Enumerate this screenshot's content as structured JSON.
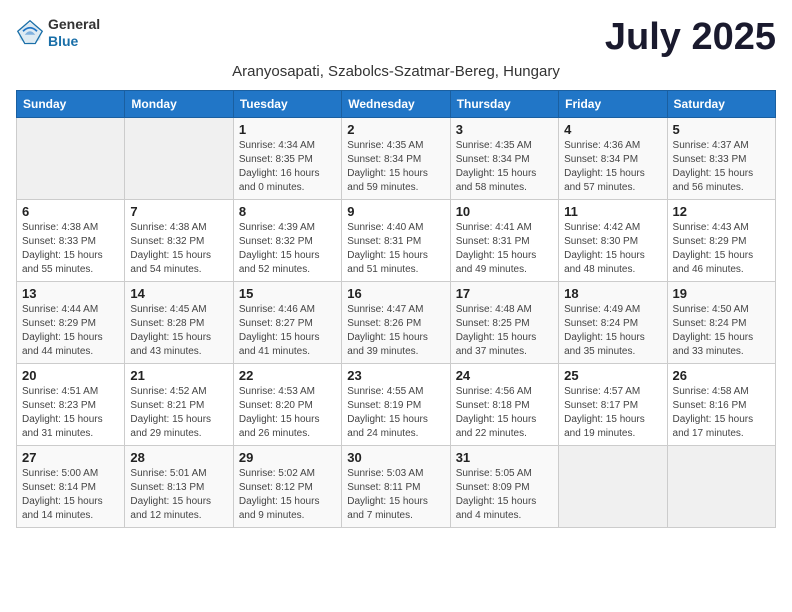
{
  "logo": {
    "general": "General",
    "blue": "Blue"
  },
  "title": "July 2025",
  "subtitle": "Aranyosapati, Szabolcs-Szatmar-Bereg, Hungary",
  "headers": [
    "Sunday",
    "Monday",
    "Tuesday",
    "Wednesday",
    "Thursday",
    "Friday",
    "Saturday"
  ],
  "weeks": [
    [
      {
        "day": "",
        "info": ""
      },
      {
        "day": "",
        "info": ""
      },
      {
        "day": "1",
        "info": "Sunrise: 4:34 AM\nSunset: 8:35 PM\nDaylight: 16 hours\nand 0 minutes."
      },
      {
        "day": "2",
        "info": "Sunrise: 4:35 AM\nSunset: 8:34 PM\nDaylight: 15 hours\nand 59 minutes."
      },
      {
        "day": "3",
        "info": "Sunrise: 4:35 AM\nSunset: 8:34 PM\nDaylight: 15 hours\nand 58 minutes."
      },
      {
        "day": "4",
        "info": "Sunrise: 4:36 AM\nSunset: 8:34 PM\nDaylight: 15 hours\nand 57 minutes."
      },
      {
        "day": "5",
        "info": "Sunrise: 4:37 AM\nSunset: 8:33 PM\nDaylight: 15 hours\nand 56 minutes."
      }
    ],
    [
      {
        "day": "6",
        "info": "Sunrise: 4:38 AM\nSunset: 8:33 PM\nDaylight: 15 hours\nand 55 minutes."
      },
      {
        "day": "7",
        "info": "Sunrise: 4:38 AM\nSunset: 8:32 PM\nDaylight: 15 hours\nand 54 minutes."
      },
      {
        "day": "8",
        "info": "Sunrise: 4:39 AM\nSunset: 8:32 PM\nDaylight: 15 hours\nand 52 minutes."
      },
      {
        "day": "9",
        "info": "Sunrise: 4:40 AM\nSunset: 8:31 PM\nDaylight: 15 hours\nand 51 minutes."
      },
      {
        "day": "10",
        "info": "Sunrise: 4:41 AM\nSunset: 8:31 PM\nDaylight: 15 hours\nand 49 minutes."
      },
      {
        "day": "11",
        "info": "Sunrise: 4:42 AM\nSunset: 8:30 PM\nDaylight: 15 hours\nand 48 minutes."
      },
      {
        "day": "12",
        "info": "Sunrise: 4:43 AM\nSunset: 8:29 PM\nDaylight: 15 hours\nand 46 minutes."
      }
    ],
    [
      {
        "day": "13",
        "info": "Sunrise: 4:44 AM\nSunset: 8:29 PM\nDaylight: 15 hours\nand 44 minutes."
      },
      {
        "day": "14",
        "info": "Sunrise: 4:45 AM\nSunset: 8:28 PM\nDaylight: 15 hours\nand 43 minutes."
      },
      {
        "day": "15",
        "info": "Sunrise: 4:46 AM\nSunset: 8:27 PM\nDaylight: 15 hours\nand 41 minutes."
      },
      {
        "day": "16",
        "info": "Sunrise: 4:47 AM\nSunset: 8:26 PM\nDaylight: 15 hours\nand 39 minutes."
      },
      {
        "day": "17",
        "info": "Sunrise: 4:48 AM\nSunset: 8:25 PM\nDaylight: 15 hours\nand 37 minutes."
      },
      {
        "day": "18",
        "info": "Sunrise: 4:49 AM\nSunset: 8:24 PM\nDaylight: 15 hours\nand 35 minutes."
      },
      {
        "day": "19",
        "info": "Sunrise: 4:50 AM\nSunset: 8:24 PM\nDaylight: 15 hours\nand 33 minutes."
      }
    ],
    [
      {
        "day": "20",
        "info": "Sunrise: 4:51 AM\nSunset: 8:23 PM\nDaylight: 15 hours\nand 31 minutes."
      },
      {
        "day": "21",
        "info": "Sunrise: 4:52 AM\nSunset: 8:21 PM\nDaylight: 15 hours\nand 29 minutes."
      },
      {
        "day": "22",
        "info": "Sunrise: 4:53 AM\nSunset: 8:20 PM\nDaylight: 15 hours\nand 26 minutes."
      },
      {
        "day": "23",
        "info": "Sunrise: 4:55 AM\nSunset: 8:19 PM\nDaylight: 15 hours\nand 24 minutes."
      },
      {
        "day": "24",
        "info": "Sunrise: 4:56 AM\nSunset: 8:18 PM\nDaylight: 15 hours\nand 22 minutes."
      },
      {
        "day": "25",
        "info": "Sunrise: 4:57 AM\nSunset: 8:17 PM\nDaylight: 15 hours\nand 19 minutes."
      },
      {
        "day": "26",
        "info": "Sunrise: 4:58 AM\nSunset: 8:16 PM\nDaylight: 15 hours\nand 17 minutes."
      }
    ],
    [
      {
        "day": "27",
        "info": "Sunrise: 5:00 AM\nSunset: 8:14 PM\nDaylight: 15 hours\nand 14 minutes."
      },
      {
        "day": "28",
        "info": "Sunrise: 5:01 AM\nSunset: 8:13 PM\nDaylight: 15 hours\nand 12 minutes."
      },
      {
        "day": "29",
        "info": "Sunrise: 5:02 AM\nSunset: 8:12 PM\nDaylight: 15 hours\nand 9 minutes."
      },
      {
        "day": "30",
        "info": "Sunrise: 5:03 AM\nSunset: 8:11 PM\nDaylight: 15 hours\nand 7 minutes."
      },
      {
        "day": "31",
        "info": "Sunrise: 5:05 AM\nSunset: 8:09 PM\nDaylight: 15 hours\nand 4 minutes."
      },
      {
        "day": "",
        "info": ""
      },
      {
        "day": "",
        "info": ""
      }
    ]
  ]
}
